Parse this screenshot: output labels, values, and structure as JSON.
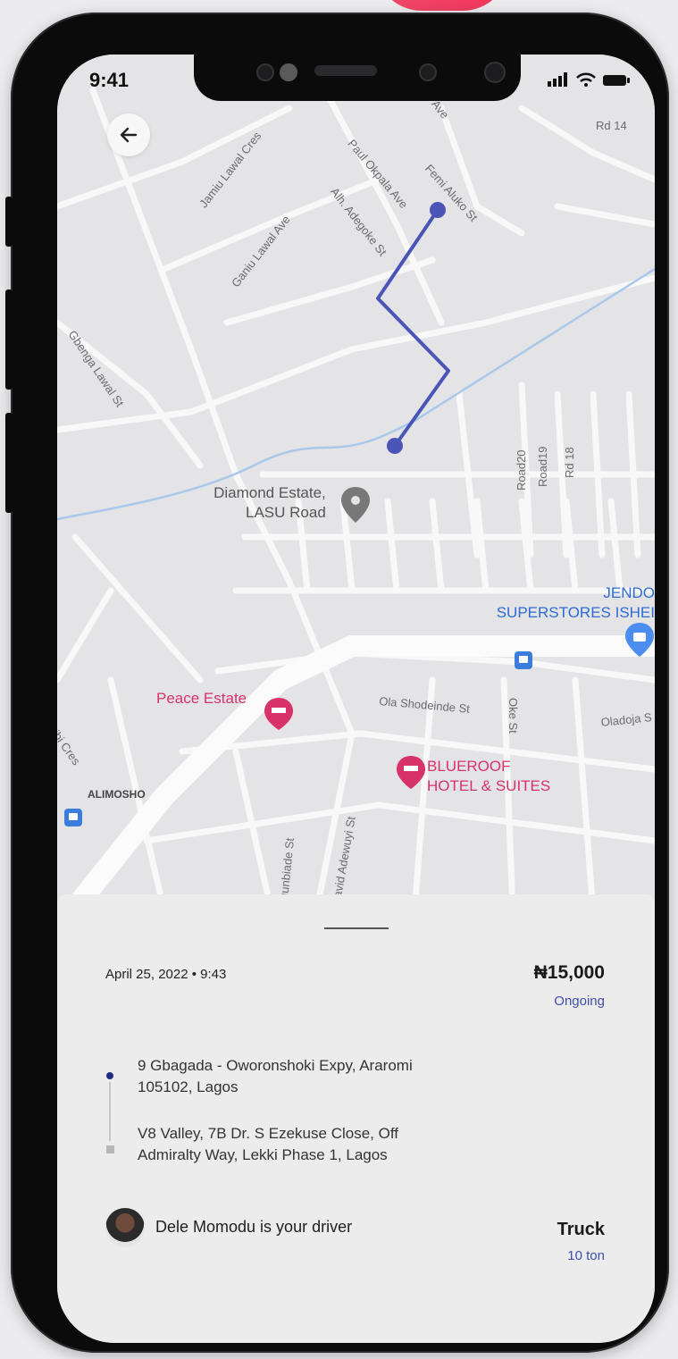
{
  "status_bar": {
    "time": "9:41"
  },
  "map": {
    "streets": [
      "Ave",
      "Rd 14",
      "Jamiu Lawal Cres",
      "Paul Okpala Ave",
      "Femi Aluko St",
      "Alh. Adegoke St",
      "Ganiu Lawal Ave",
      "Gbenga Lawal St",
      "Road20",
      "Road19",
      "Rd 18",
      "Ola Shodeinde St",
      "Oke St",
      "Oladoja S",
      "yibi Cres",
      "gunbiade St",
      "avid Adewuyi St"
    ],
    "area_label": "ALIMOSHO",
    "pois": {
      "diamond_estate": {
        "line1": "Diamond Estate,",
        "line2": "LASU Road",
        "icon": "map-pin-icon"
      },
      "jendol": {
        "line1": "JENDO",
        "line2": "SUPERSTORES ISHEI",
        "icon": "shopping-bag-icon"
      },
      "peace_estate": {
        "label": "Peace Estate",
        "icon": "hotel-icon"
      },
      "blueroof": {
        "line1": "BLUEROOF",
        "line2": "HOTEL & SUITES",
        "icon": "hotel-icon"
      }
    },
    "route_color": "#4b55b8",
    "poi_pink": "#d8326a",
    "poi_blue": "#2d6bd6"
  },
  "trip": {
    "datetime": "April 25, 2022 • 9:43",
    "price": "₦15,000",
    "status": "Ongoing",
    "pickup": "9 Gbagada - Oworonshoki Expy, Araromi 105102, Lagos",
    "dropoff": "V8 Valley, 7B Dr. S Ezekuse Close, Off Admiralty Way, Lekki Phase 1, Lagos",
    "driver_text": "Dele Momodu  is your driver",
    "vehicle": "Truck",
    "capacity": "10 ton"
  }
}
